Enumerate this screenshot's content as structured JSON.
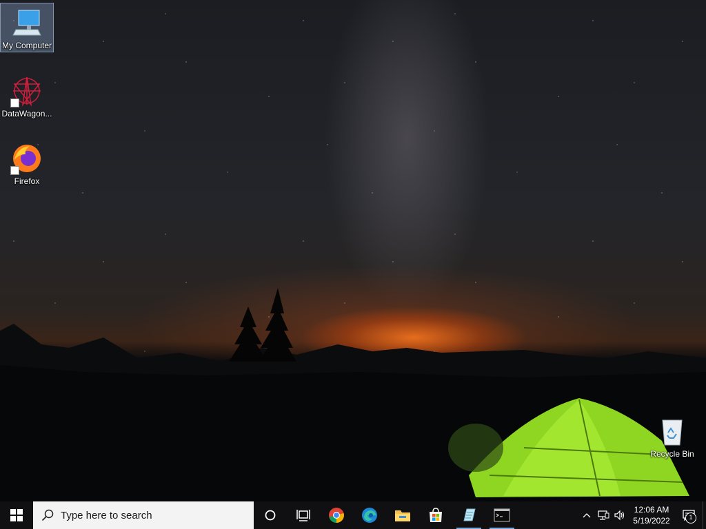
{
  "desktop": {
    "icons": [
      {
        "label": "My Computer",
        "icon": "computer-icon"
      },
      {
        "label": "DataWagon...",
        "icon": "datawagon-icon"
      },
      {
        "label": "Firefox",
        "icon": "firefox-icon"
      },
      {
        "label": "Recycle Bin",
        "icon": "recycle-bin-icon"
      }
    ]
  },
  "taskbar": {
    "search_placeholder": "Type here to search",
    "apps": [
      {
        "name": "Cortana",
        "icon": "cortana-icon"
      },
      {
        "name": "Task View",
        "icon": "task-view-icon"
      },
      {
        "name": "Chrome",
        "icon": "chrome-icon"
      },
      {
        "name": "Edge",
        "icon": "edge-icon"
      },
      {
        "name": "File Explorer",
        "icon": "file-explorer-icon"
      },
      {
        "name": "Microsoft Store",
        "icon": "store-icon"
      },
      {
        "name": "Notepad",
        "icon": "notepad-icon"
      },
      {
        "name": "Command Prompt",
        "icon": "cmd-icon"
      }
    ],
    "clock": {
      "time": "12:06 AM",
      "date": "5/19/2022"
    },
    "notification_count": "1"
  },
  "colors": {
    "taskbar": "#101012",
    "accent": "#7aa7d8",
    "tent": "#9be02a"
  }
}
